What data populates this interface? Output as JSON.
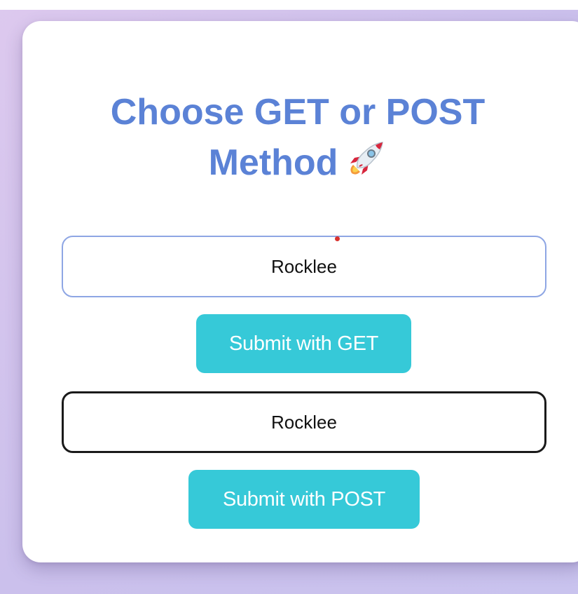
{
  "form": {
    "title": "Choose GET or POST Method",
    "title_icon": "rocket-icon",
    "get_input_value": "Rocklee",
    "get_button_label": "Submit with GET",
    "post_input_value": "Rocklee",
    "post_button_label": "Submit with POST"
  },
  "colors": {
    "title": "#5b82d6",
    "button": "#36c9d8",
    "get_input_border": "#8ea6e4",
    "post_input_border": "#1a1a1a",
    "background_gradient": [
      "#ddc9ee",
      "#c9c3ee"
    ]
  }
}
